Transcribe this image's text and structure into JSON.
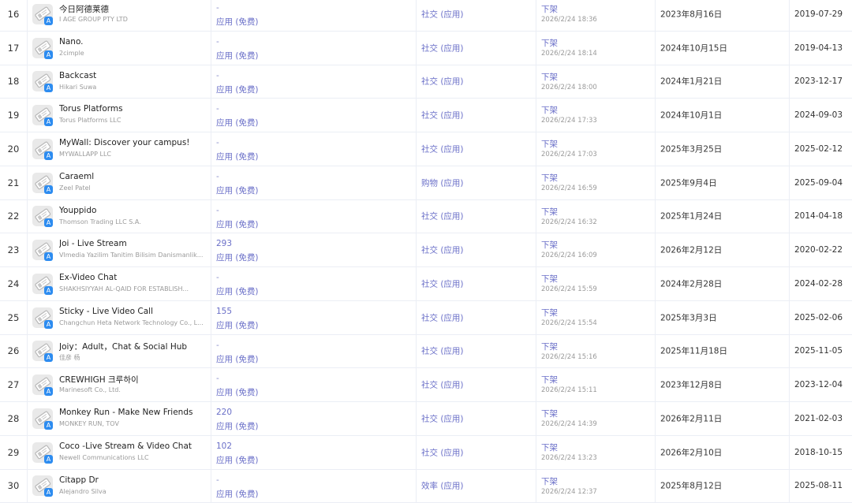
{
  "colors": {
    "link": "#6a6fc8",
    "text": "#333333",
    "muted": "#9a9a9a",
    "store_badge": "#2d8cf0",
    "row_border": "#ebeef5"
  },
  "icons": {
    "placeholder": "image-placeholder-icon",
    "store": "app-store-icon"
  },
  "rows": [
    {
      "rank": "16",
      "name": "今日阿德莱德",
      "developer": "I AGE GROUP PTY LTD",
      "rating": "-",
      "price_type": "应用 (免费)",
      "category": "社交 (应用)",
      "status": "下架",
      "status_time": "2026/2/24 18:36",
      "release_date": "2023年8月16日",
      "update_date": "2019-07-29"
    },
    {
      "rank": "17",
      "name": "Nano.",
      "developer": "2cimple",
      "rating": "-",
      "price_type": "应用 (免费)",
      "category": "社交 (应用)",
      "status": "下架",
      "status_time": "2026/2/24 18:14",
      "release_date": "2024年10月15日",
      "update_date": "2019-04-13"
    },
    {
      "rank": "18",
      "name": "Backcast",
      "developer": "Hikari Suwa",
      "rating": "-",
      "price_type": "应用 (免费)",
      "category": "社交 (应用)",
      "status": "下架",
      "status_time": "2026/2/24 18:00",
      "release_date": "2024年1月21日",
      "update_date": "2023-12-17"
    },
    {
      "rank": "19",
      "name": "Torus Platforms",
      "developer": "Torus Platforms LLC",
      "rating": "-",
      "price_type": "应用 (免费)",
      "category": "社交 (应用)",
      "status": "下架",
      "status_time": "2026/2/24 17:33",
      "release_date": "2024年10月1日",
      "update_date": "2024-09-03"
    },
    {
      "rank": "20",
      "name": "MyWall: Discover your campus!",
      "developer": "MYWALLAPP LLC",
      "rating": "-",
      "price_type": "应用 (免费)",
      "category": "社交 (应用)",
      "status": "下架",
      "status_time": "2026/2/24 17:03",
      "release_date": "2025年3月25日",
      "update_date": "2025-02-12"
    },
    {
      "rank": "21",
      "name": "Caraeml",
      "developer": "Zeel Patel",
      "rating": "-",
      "price_type": "应用 (免费)",
      "category": "购物 (应用)",
      "status": "下架",
      "status_time": "2026/2/24 16:59",
      "release_date": "2025年9月4日",
      "update_date": "2025-09-04"
    },
    {
      "rank": "22",
      "name": "Youppido",
      "developer": "Thomson Trading LLC S.A.",
      "rating": "-",
      "price_type": "应用 (免费)",
      "category": "社交 (应用)",
      "status": "下架",
      "status_time": "2026/2/24 16:32",
      "release_date": "2025年1月24日",
      "update_date": "2014-04-18"
    },
    {
      "rank": "23",
      "name": "Joi - Live Stream",
      "developer": "Vlmedia Yazilim Tanitim Bilisim Danismanlik...",
      "rating": "293",
      "price_type": "应用 (免费)",
      "category": "社交 (应用)",
      "status": "下架",
      "status_time": "2026/2/24 16:09",
      "release_date": "2026年2月12日",
      "update_date": "2020-02-22"
    },
    {
      "rank": "24",
      "name": "Ex-Video Chat",
      "developer": "SHAKHSIYYAH AL-QAID FOR ESTABLISH...",
      "rating": "-",
      "price_type": "应用 (免费)",
      "category": "社交 (应用)",
      "status": "下架",
      "status_time": "2026/2/24 15:59",
      "release_date": "2024年2月28日",
      "update_date": "2024-02-28"
    },
    {
      "rank": "25",
      "name": "Sticky - Live Video Call",
      "developer": "Changchun Heta Network Technology Co., L...",
      "rating": "155",
      "price_type": "应用 (免费)",
      "category": "社交 (应用)",
      "status": "下架",
      "status_time": "2026/2/24 15:54",
      "release_date": "2025年3月3日",
      "update_date": "2025-02-06"
    },
    {
      "rank": "26",
      "name": "Joiy：Adult，Chat & Social Hub",
      "developer": "佳彦 杨",
      "rating": "-",
      "price_type": "应用 (免费)",
      "category": "社交 (应用)",
      "status": "下架",
      "status_time": "2026/2/24 15:16",
      "release_date": "2025年11月18日",
      "update_date": "2025-11-05"
    },
    {
      "rank": "27",
      "name": "CREWHIGH 크루하이",
      "developer": "Marinesoft Co., Ltd.",
      "rating": "-",
      "price_type": "应用 (免费)",
      "category": "社交 (应用)",
      "status": "下架",
      "status_time": "2026/2/24 15:11",
      "release_date": "2023年12月8日",
      "update_date": "2023-12-04"
    },
    {
      "rank": "28",
      "name": "Monkey Run - Make New Friends",
      "developer": "MONKEY RUN, TOV",
      "rating": "220",
      "price_type": "应用 (免费)",
      "category": "社交 (应用)",
      "status": "下架",
      "status_time": "2026/2/24 14:39",
      "release_date": "2026年2月11日",
      "update_date": "2021-02-03"
    },
    {
      "rank": "29",
      "name": "Coco -Live Stream & Video Chat",
      "developer": "Newell Communications LLC",
      "rating": "102",
      "price_type": "应用 (免费)",
      "category": "社交 (应用)",
      "status": "下架",
      "status_time": "2026/2/24 13:23",
      "release_date": "2026年2月10日",
      "update_date": "2018-10-15"
    },
    {
      "rank": "30",
      "name": "Citapp Dr",
      "developer": "Alejandro Silva",
      "rating": "-",
      "price_type": "应用 (免费)",
      "category": "效率 (应用)",
      "status": "下架",
      "status_time": "2026/2/24 12:37",
      "release_date": "2025年8月12日",
      "update_date": "2025-08-11"
    }
  ]
}
